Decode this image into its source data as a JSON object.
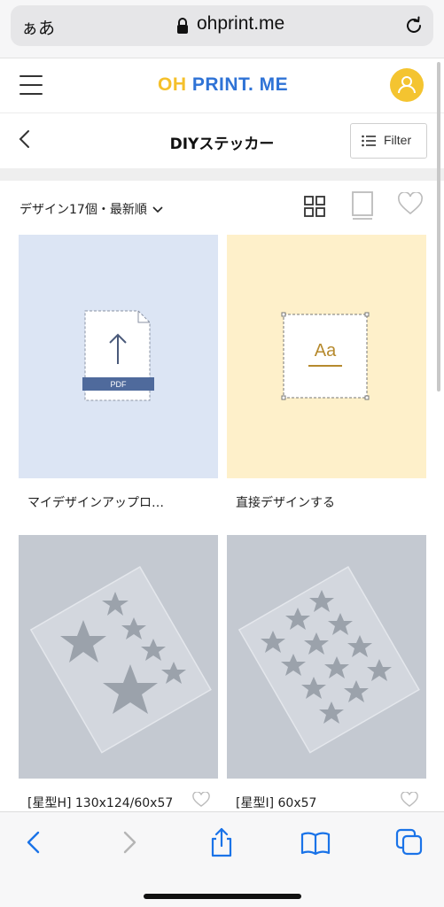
{
  "browser": {
    "aa_label": "ぁあ",
    "url": "ohprint.me",
    "icons": {
      "lock": "lock-icon",
      "reload": "reload-icon"
    }
  },
  "header": {
    "logo_oh": "OH",
    "logo_rest": "PRINT. ME",
    "colors": {
      "logo_yellow": "#f5c02b",
      "logo_blue": "#2f73d6",
      "avatar": "#f4c430"
    }
  },
  "title_bar": {
    "title": "DIYステッカー",
    "filter_label": "Filter"
  },
  "toolbar": {
    "sort_label": "デザイン17個・最新順"
  },
  "cards": [
    {
      "label": "マイデザインアップロ…",
      "icon_text": "PDF",
      "background": "#dce5f4"
    },
    {
      "label": "直接デザインする",
      "icon_text": "Aa",
      "background": "#fef0ca"
    },
    {
      "label": "[星型H] 130x124/60x57",
      "background": "#c4c9d1"
    },
    {
      "label": "[星型I] 60x57",
      "background": "#c4c9d1"
    }
  ],
  "bottom_bar": {
    "buttons": [
      "back-icon",
      "forward-icon",
      "share-icon",
      "bookmarks-icon",
      "tabs-icon"
    ]
  }
}
